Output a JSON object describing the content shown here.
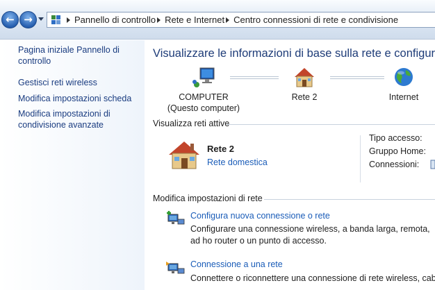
{
  "address_bar": {
    "breadcrumbs": [
      "Pannello di controllo",
      "Rete e Internet",
      "Centro connessioni di rete e condivisione"
    ],
    "icons": {
      "back": "back-arrow-icon",
      "forward": "forward-arrow-icon",
      "root": "control-panel-icon"
    }
  },
  "left_pane": {
    "links": [
      "Pagina iniziale Pannello di controllo",
      "Gestisci reti wireless",
      "Modifica impostazioni scheda",
      "Modifica impostazioni di condivisione avanzate"
    ]
  },
  "main": {
    "title": "Visualizzare le informazioni di base sulla rete e configurare",
    "network_map": {
      "computer_line1": "COMPUTER",
      "computer_line2": "(Questo computer)",
      "network": "Rete  2",
      "internet": "Internet"
    },
    "active_networks": {
      "header": "Visualizza reti attive",
      "network_name": "Rete  2",
      "network_type": "Rete domestica",
      "properties": [
        "Tipo accesso:",
        "Gruppo Home:",
        "Connessioni:"
      ]
    },
    "change_settings": {
      "header": "Modifica impostazioni di rete",
      "tasks": [
        {
          "link": "Configura nuova connessione o rete",
          "description": "Configurare una connessione wireless, a banda larga, remota, ad ho router o un punto di accesso."
        },
        {
          "link": "Connessione a una rete",
          "description": "Connettere o riconnettere una connessione di rete wireless, cablata"
        }
      ]
    }
  },
  "colors": {
    "link": "#1a5cb8",
    "title": "#1e3c78",
    "nav_link": "#1a3c80"
  }
}
